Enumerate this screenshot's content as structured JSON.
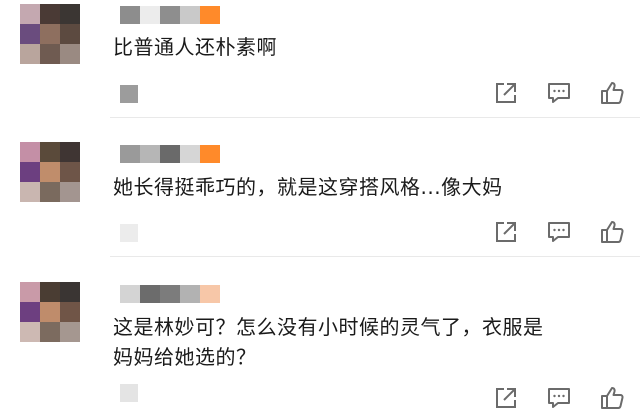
{
  "colors": {
    "text": "#1a1a1a",
    "icon": "#6b6b6b",
    "accent": "#ff8a2a"
  },
  "icons": {
    "share": "share-icon",
    "reply": "comment-icon",
    "like": "thumbs-up-icon"
  },
  "comments": [
    {
      "text_lines": [
        "比普通人还朴素啊"
      ],
      "avatar_pixels": [
        "#c4a8b0",
        "#4a3a35",
        "#3b3633",
        "#6a4c7e",
        "#8e6f5f",
        "#5c4a40",
        "#b9a59d",
        "#6f5b51",
        "#9a8a82"
      ],
      "name_pixels": [
        "#8d8d8d",
        "#ececec",
        "#8e8e8e",
        "#c9c9c9",
        "#ff8a2a"
      ]
    },
    {
      "text_lines": [
        "她长得挺乖巧的，就是这穿搭风格...像大妈"
      ],
      "avatar_pixels": [
        "#c48fa6",
        "#5a4a3a",
        "#3f3533",
        "#6c3f80",
        "#c08d6b",
        "#6e5548",
        "#c9b6b0",
        "#7a6a5e",
        "#a39590"
      ],
      "name_pixels": [
        "#9a9a9a",
        "#b6b6b6",
        "#6a6a6a",
        "#d6d6d6",
        "#ff8a2a"
      ]
    },
    {
      "text_lines": [
        "这是林妙可？怎么没有小时候的灵气了，衣服是",
        "妈妈给她选的？"
      ],
      "avatar_pixels": [
        "#c99aa8",
        "#4a3d33",
        "#3a3533",
        "#6d3f80",
        "#bf8c6b",
        "#705547",
        "#cdb9b3",
        "#7c6b5f",
        "#a59790"
      ],
      "name_pixels": [
        "#d4d4d4",
        "#6c6c6c",
        "#7c7c7c",
        "#b2b2b2",
        "#f7c7a8"
      ]
    }
  ]
}
